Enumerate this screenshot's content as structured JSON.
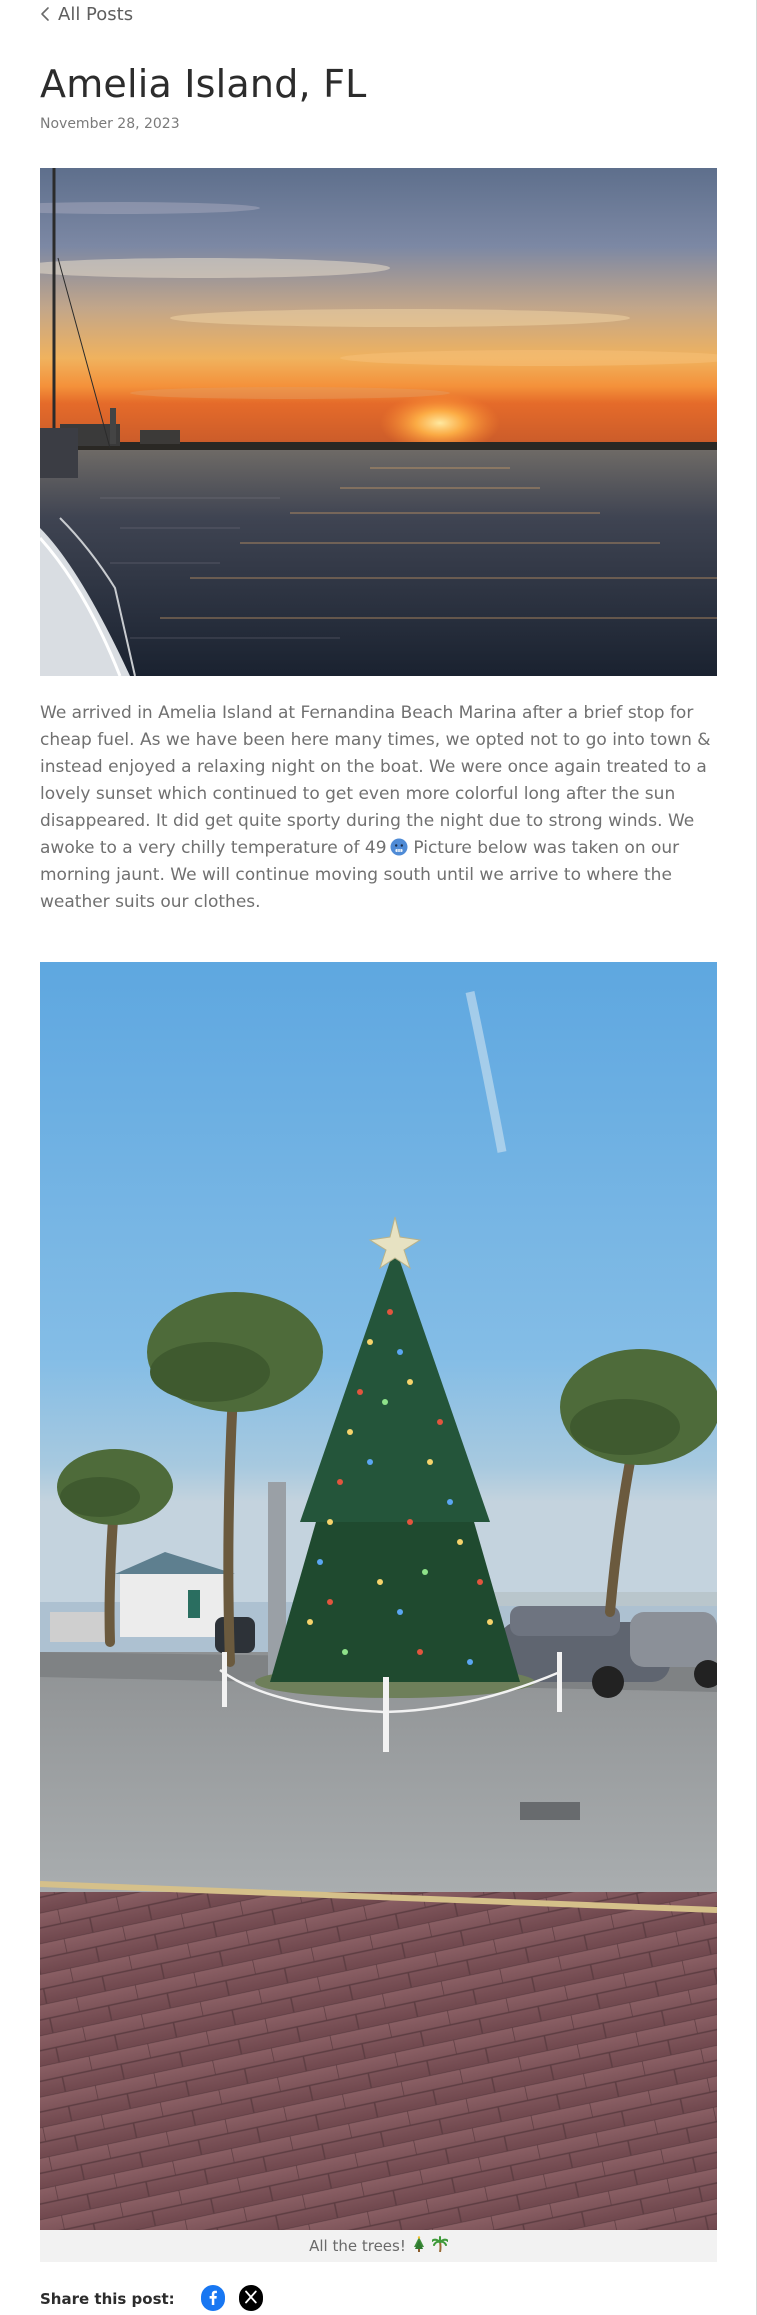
{
  "nav": {
    "back_label": "All Posts"
  },
  "post": {
    "title": "Amelia Island, FL",
    "date": "November 28, 2023",
    "body_part1": "We arrived in Amelia Island at Fernandina Beach Marina after a brief stop for cheap fuel. As we have been here many times, we opted not to go into town & instead enjoyed a relaxing night on the boat. We were once again treated to a lovely sunset which continued to get even more colorful long after the sun disappeared. It did get quite sporty during the night due to strong winds. We awoke to a very chilly temperature of 49",
    "body_part2": " Picture below was taken on our morning jaunt. We will continue moving south until we arrive to where the weather suits our clothes.",
    "caption": "All the trees!"
  },
  "share": {
    "label": "Share this post:"
  },
  "icons": {
    "back": "chevron-left-icon",
    "cold_face": "cold-face-emoji",
    "tree": "christmas-tree-emoji",
    "palm": "palm-tree-emoji",
    "facebook": "facebook-icon",
    "x": "x-icon"
  },
  "colors": {
    "title": "#2c2c2c",
    "body_text": "#707070",
    "caption_bg": "#f2f2f2",
    "facebook_blue": "#1877f2",
    "x_black": "#000000"
  }
}
